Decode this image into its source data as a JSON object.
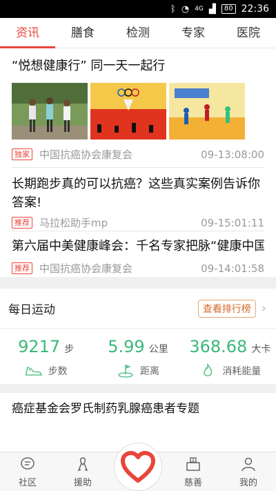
{
  "status_bar": {
    "network": "4G",
    "battery": "80",
    "time": "22:36"
  },
  "tabs": [
    {
      "label": "资讯",
      "active": true
    },
    {
      "label": "膳食",
      "active": false
    },
    {
      "label": "检测",
      "active": false
    },
    {
      "label": "专家",
      "active": false
    },
    {
      "label": "医院",
      "active": false
    }
  ],
  "articles": [
    {
      "title": "“悦想健康行” 同一天一起行",
      "badge": "独家",
      "source": "中国抗癌协会康复会",
      "time": "09-13:08:00"
    },
    {
      "title": "长期跑步真的可以抗癌？这些真实案例告诉你答案!",
      "badge": "推荐",
      "source": "马拉松助手mp",
      "time": "09-15:01:11"
    },
    {
      "title": "第六届中美健康峰会：千名专家把脉“健康中国",
      "badge": "推荐",
      "source": "中国抗癌协会康复会",
      "time": "09-14:01:58"
    }
  ],
  "sport": {
    "title": "每日运动",
    "rank_button": "查看排行榜",
    "steps": {
      "value": "9217",
      "unit": "步",
      "label": "步数"
    },
    "distance": {
      "value": "5.99",
      "unit": "公里",
      "label": "距离"
    },
    "calories": {
      "value": "368.68",
      "unit": "大卡",
      "label": "消耗能量"
    }
  },
  "topic": {
    "title": "癌症基金会罗氏制药乳腺癌患者专题"
  },
  "bottom_nav": {
    "community": "社区",
    "aid": "援助",
    "charity": "慈善",
    "mine": "我的"
  },
  "colors": {
    "accent": "#e8463a",
    "green": "#3bb878",
    "orange": "#d36a2b"
  },
  "icons": [
    "chevron-right-icon",
    "shoe-icon",
    "golf-flag-icon",
    "flame-icon",
    "chat-bubble-icon",
    "ribbon-icon",
    "heart-icon",
    "donation-box-icon",
    "person-icon"
  ]
}
